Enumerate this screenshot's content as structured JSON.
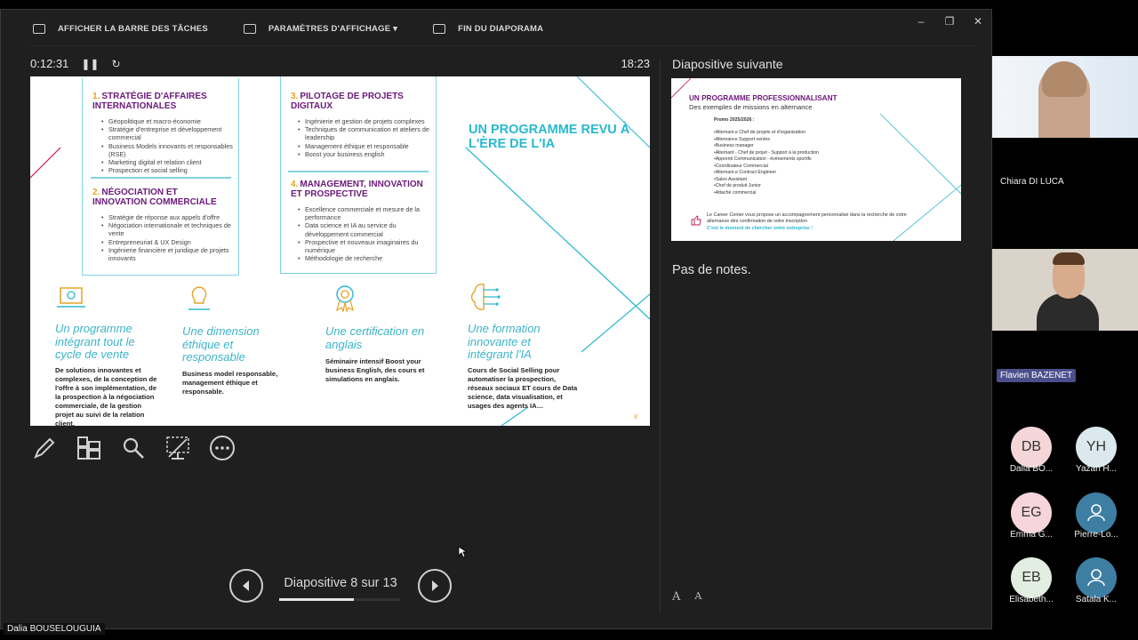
{
  "presenter": {
    "toolbar": {
      "taskbar": "AFFICHER LA BARRE DES TÂCHES",
      "display_settings": "PARAMÈTRES D'AFFICHAGE ▾",
      "end_show": "FIN DU DIAPORAMA"
    },
    "window_controls": {
      "minimize": "–",
      "restore": "❐",
      "close": "✕"
    },
    "elapsed": "0:12:31",
    "clock": "18:23",
    "next_label": "Diapositive suivante",
    "notes": "Pas de notes.",
    "nav": {
      "text": "Diapositive 8 sur 13",
      "progress": 0.62
    },
    "font_ctrls": {
      "increase": "A",
      "decrease": "A"
    }
  },
  "slide": {
    "big_title": "UN PROGRAMME REVU À L'ÈRE DE L'IA",
    "sections": [
      {
        "num": "1.",
        "title": "STRATÉGIE D'AFFAIRES INTERNATIONALES",
        "items": [
          "Géopolitique et macro-économie",
          "Stratégie d'entreprise et développement commercial",
          "Business Models innovants et responsables (RSE)",
          "Marketing digital et relation client",
          "Prospection et social selling"
        ]
      },
      {
        "num": "2.",
        "title": "NÉGOCIATION ET INNOVATION COMMERCIALE",
        "items": [
          "Stratégie de réponse aux appels d'offre",
          "Négociation internationale et techniques de vente",
          "Entrepreneuriat & UX Design",
          "Ingénierie financière et juridique de projets innovants"
        ]
      },
      {
        "num": "3.",
        "title": "PILOTAGE DE PROJETS DIGITAUX",
        "items": [
          "Ingénierie et gestion de projets complexes",
          "Techniques de communication et ateliers de leadership",
          "Management éthique et responsable",
          "Boost your business english"
        ]
      },
      {
        "num": "4.",
        "title": "MANAGEMENT, INNOVATION ET PROSPECTIVE",
        "items": [
          "Excellence commerciale et mesure de la performance",
          "Data science et IA au service du développement commercial",
          "Prospective et nouveaux imaginaires du numérique",
          "Méthodologie de recherche"
        ]
      }
    ],
    "columns": [
      {
        "title": "Un programme intégrant tout le cycle de vente",
        "text": "De solutions innovantes et complexes, de la conception de l'offre à son implémentation, de la prospection à la négociation commerciale, de la gestion projet au suivi de la relation client."
      },
      {
        "title": "Une dimension éthique et responsable",
        "text": "Business model responsable, management éthique et responsable."
      },
      {
        "title": "Une certification en anglais",
        "text": "Séminaire intensif Boost your business English, des cours et simulations en anglais."
      },
      {
        "title": "Une formation innovante et intégrant l'IA",
        "text": "Cours de Social Selling pour automatiser la prospection, réseaux sociaux ET cours de Data science, data visualisation, et usages des agents IA…"
      }
    ],
    "page_number": "8"
  },
  "next_slide": {
    "title": "UN PROGRAMME PROFESSIONNALISANT",
    "subtitle": "Des exemples de missions en alternance",
    "promo": "Promo 2025/2026 :",
    "items": [
      "•Alternant.e Chef de projets et d'organisation",
      "•Alternance Support ventes",
      "•Business manager",
      "•Alternant - Chef de projet - Support à la production",
      "•Apprenti Communication - événements sportifs",
      "•Coordinateur Commercial",
      "•Alternant.e Contract Engineer",
      "•Sales Assistant",
      "•Chef de produit Junior",
      "•Attaché commercial"
    ],
    "footer": "Le Career Center vous propose un accompagnement personnalisé dans la recherche de votre alternance dès confirmation de votre inscription",
    "footer2": "C'est le moment de chercher votre entreprise !"
  },
  "self_name": "Dalia BOUSELOUGUIA",
  "participants": {
    "video1_name": "Chiara DI LUCA",
    "video2_name": "Flavien BAZENET",
    "avatars": [
      {
        "initials": "DB",
        "name": "Dalia BO...",
        "color": "#f4d6d9"
      },
      {
        "initials": "YH",
        "name": "Yazan H...",
        "color": "#dbe9ee"
      },
      {
        "initials": "EG",
        "name": "Emma G...",
        "color": "#f7d5dc"
      },
      {
        "initials": "",
        "name": "Pierre-Lo...",
        "color": "#3e7ea3",
        "icon": "person-icon"
      },
      {
        "initials": "EB",
        "name": "Elisabeth...",
        "color": "#e2eee1"
      },
      {
        "initials": "",
        "name": "Satala K...",
        "color": "#3e7ea3",
        "icon": "person-icon"
      }
    ]
  }
}
